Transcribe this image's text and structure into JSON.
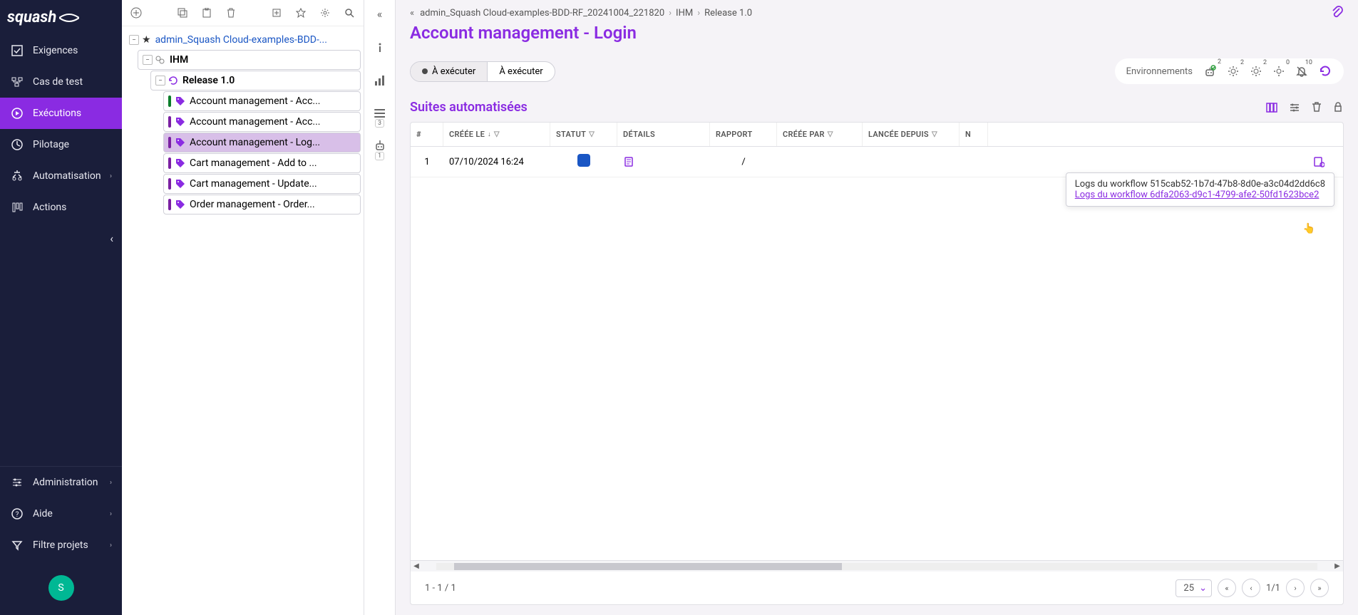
{
  "logo": "squash",
  "sidebar": {
    "items": [
      {
        "label": "Exigences",
        "icon": "check-square"
      },
      {
        "label": "Cas de test",
        "icon": "flow"
      },
      {
        "label": "Exécutions",
        "icon": "play-circle",
        "active": true
      },
      {
        "label": "Pilotage",
        "icon": "gauge"
      },
      {
        "label": "Automatisation",
        "icon": "robot",
        "chevron": true
      },
      {
        "label": "Actions",
        "icon": "columns"
      }
    ],
    "bottom": [
      {
        "label": "Administration",
        "icon": "sliders",
        "chevron": true
      },
      {
        "label": "Aide",
        "icon": "help",
        "chevron": true
      },
      {
        "label": "Filtre projets",
        "icon": "filter",
        "chevron": true
      }
    ],
    "user_initial": "S"
  },
  "tree": {
    "root": {
      "label": "admin_Squash Cloud-examples-BDD-...",
      "starred": true
    },
    "folder": {
      "label": "IHM"
    },
    "release": {
      "label": "Release 1.0"
    },
    "items": [
      {
        "label": "Account management - Acc...",
        "stripe": "#0a7d2a"
      },
      {
        "label": "Account management - Acc...",
        "stripe": "#7a1fa2"
      },
      {
        "label": "Account management - Log...",
        "stripe": "#7a1fa2",
        "selected": true
      },
      {
        "label": "Cart management - Add to ...",
        "stripe": "#7a1fa2"
      },
      {
        "label": "Cart management - Update...",
        "stripe": "#7a1fa2"
      },
      {
        "label": "Order management - Order...",
        "stripe": "#7a1fa2"
      }
    ]
  },
  "vbar": {
    "info": "i",
    "chart": "chart",
    "list_badge": "3",
    "robot_badge": "1"
  },
  "breadcrumb": {
    "p1": "admin_Squash Cloud-examples-BDD-RF_20241004_221820",
    "p2": "IHM",
    "p3": "Release 1.0"
  },
  "title": "Account management - Login",
  "exec": {
    "left": "À exécuter",
    "right": "À exécuter"
  },
  "env": {
    "label": "Environnements",
    "robot_count": "2",
    "gear1_count": "2",
    "gear2_count": "2",
    "bell_count": "0",
    "bolt_count": "10"
  },
  "section": "Suites automatisées",
  "columns": {
    "num": "#",
    "created": "CRÉÉE LE",
    "status": "STATUT",
    "details": "DÉTAILS",
    "report": "RAPPORT",
    "createdby": "CRÉÉE PAR",
    "launched": "LANCÉE DEPUIS",
    "n": "N"
  },
  "rows": [
    {
      "num": "1",
      "date": "07/10/2024 16:24",
      "report": "/"
    }
  ],
  "tooltip": {
    "line1": "Logs du workflow 515cab52-1b7d-47b8-8d0e-a3c04d2dd6c8",
    "line2": "Logs du workflow 6dfa2063-d9c1-4799-afe2-50fd1623bce2"
  },
  "pager": {
    "range": "1 - 1 / 1",
    "size": "25",
    "pages": "1/1"
  }
}
